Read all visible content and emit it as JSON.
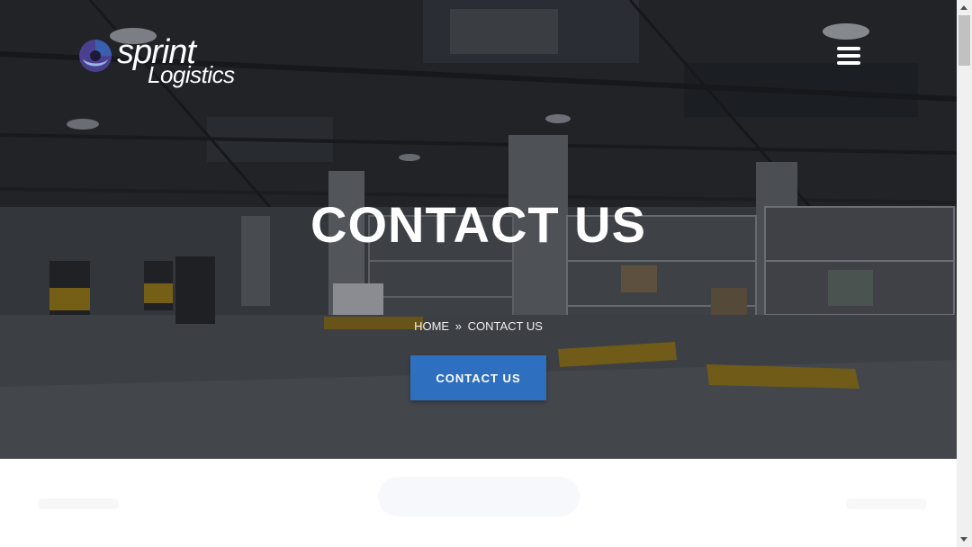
{
  "brand": {
    "line1": "sprint",
    "line2": "Logistics",
    "colors": {
      "accent": "#2f6fc0",
      "mark_blue": "#3a5fb0",
      "mark_purple": "#4b3f8f"
    }
  },
  "header": {
    "menu_icon": "hamburger-menu-icon"
  },
  "hero": {
    "title": "CONTACT US",
    "breadcrumb": {
      "home": "HOME",
      "separator": "»",
      "current": "CONTACT US"
    },
    "cta_label": "CONTACT US"
  }
}
